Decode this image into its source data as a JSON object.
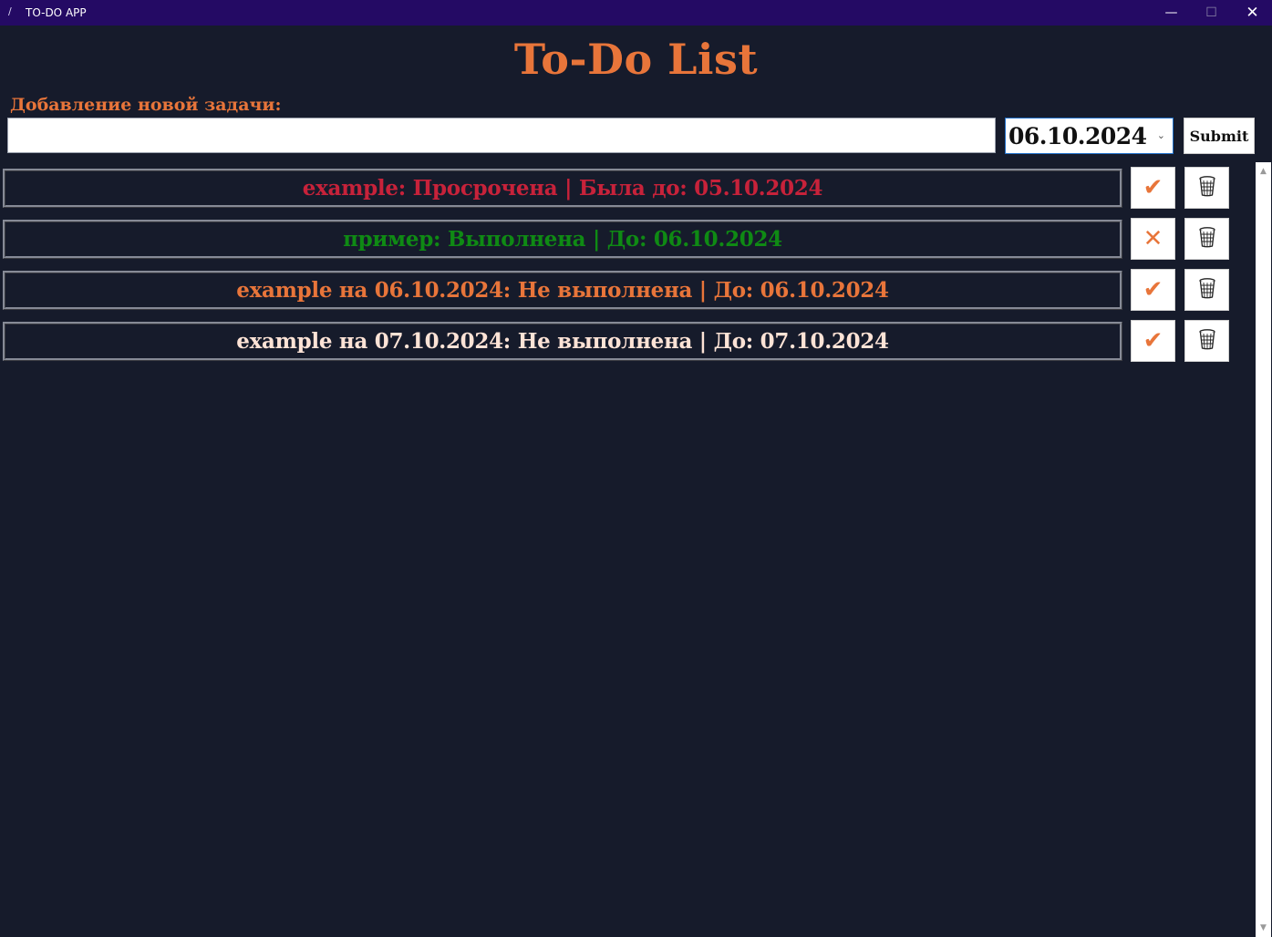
{
  "window": {
    "title": "TO-DO APP",
    "controls": {
      "minimize": "—",
      "maximize": "☐",
      "close": "✕"
    }
  },
  "header": {
    "title": "To-Do List"
  },
  "form": {
    "label": "Добавление новой задачи:",
    "input_value": "",
    "date_value": "06.10.2024",
    "submit_label": "Submit"
  },
  "tasks": [
    {
      "text": "example: Просрочена | Была до: 05.10.2024",
      "color": "#c7223a",
      "toggle_icon": "check-icon",
      "toggle_glyph": "✔"
    },
    {
      "text": "пример: Выполнена | До: 06.10.2024",
      "color": "#0f8a14",
      "toggle_icon": "cross-icon",
      "toggle_glyph": "✕"
    },
    {
      "text": "example на 06.10.2024: Не выполнена | До: 06.10.2024",
      "color": "#e8753a",
      "toggle_icon": "check-icon",
      "toggle_glyph": "✔"
    },
    {
      "text": "example на 07.10.2024: Не выполнена | До: 07.10.2024",
      "color": "#fde3d6",
      "toggle_icon": "check-icon",
      "toggle_glyph": "✔"
    }
  ],
  "colors": {
    "background": "#161b2b",
    "titlebar": "#240a64",
    "accent": "#e8753a"
  }
}
